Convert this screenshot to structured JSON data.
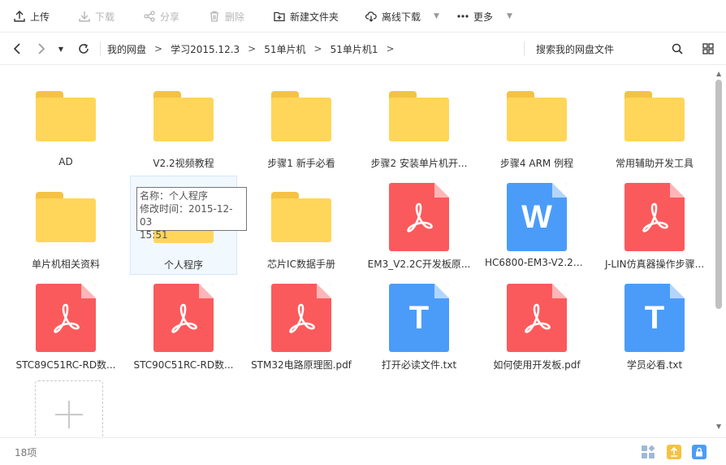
{
  "toolbar": {
    "upload": "上传",
    "download": "下载",
    "share": "分享",
    "delete": "删除",
    "new_folder": "新建文件夹",
    "offline_download": "离线下载",
    "more": "更多"
  },
  "breadcrumb": [
    "我的网盘",
    "学习2015.12.3",
    "51单片机",
    "51单片机1"
  ],
  "search": {
    "placeholder": "搜索我的网盘文件"
  },
  "files": [
    {
      "name": "AD",
      "type": "folder"
    },
    {
      "name": "V2.2视频教程",
      "type": "folder"
    },
    {
      "name": "步骤1 新手必看",
      "type": "folder"
    },
    {
      "name": "步骤2 安装单片机开...",
      "type": "folder"
    },
    {
      "name": "步骤4 ARM 例程",
      "type": "folder"
    },
    {
      "name": "常用辅助开发工具",
      "type": "folder"
    },
    {
      "name": "单片机相关资料",
      "type": "folder"
    },
    {
      "name": "个人程序",
      "type": "folder"
    },
    {
      "name": "芯片IC数据手册",
      "type": "folder"
    },
    {
      "name": "EM3_V2.2C开发板原...",
      "type": "pdf"
    },
    {
      "name": "HC6800-EM3-V2.2C...",
      "type": "word"
    },
    {
      "name": "J-LIN仿真器操作步骤...",
      "type": "pdf"
    },
    {
      "name": "STC89C51RC-RD数...",
      "type": "pdf"
    },
    {
      "name": "STC90C51RC-RD数...",
      "type": "pdf"
    },
    {
      "name": "STM32电路原理图.pdf",
      "type": "pdf"
    },
    {
      "name": "打开必读文件.txt",
      "type": "txt"
    },
    {
      "name": "如何使用开发板.pdf",
      "type": "pdf"
    },
    {
      "name": "学员必看.txt",
      "type": "txt"
    }
  ],
  "tooltip": {
    "name_line": "名称：个人程序",
    "time_line1": "修改时间：2015-12-03",
    "time_line2": "15:51"
  },
  "status": {
    "count": "18项"
  },
  "colors": {
    "folder": "#ffd659",
    "pdf": "#fb5a5c",
    "word": "#4b9cf9",
    "txt": "#4b9cf9",
    "upload_green": "#f5c244",
    "lock_blue": "#4b9cf9"
  }
}
